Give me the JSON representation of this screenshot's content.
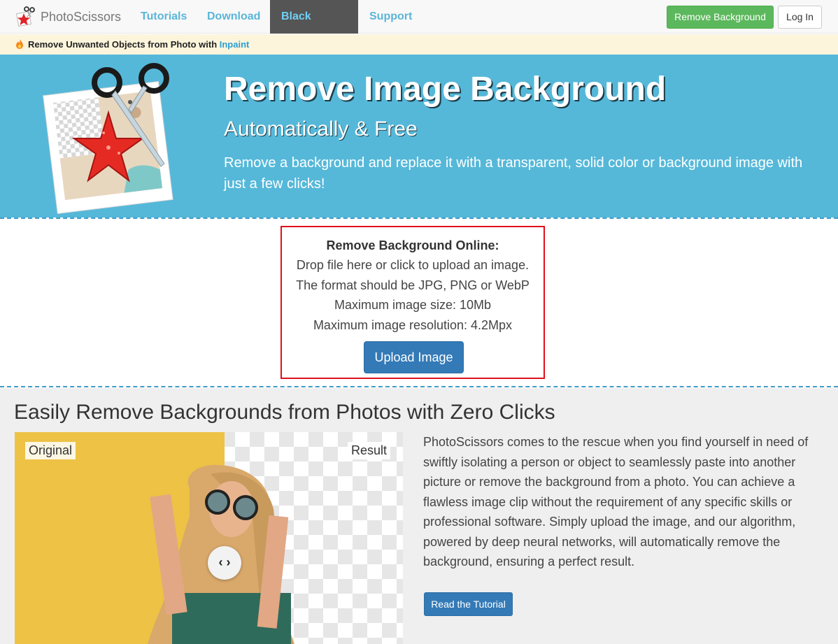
{
  "brand": {
    "name": "PhotoScissors",
    "logo_icon": "scissors-star-logo-icon"
  },
  "nav": {
    "links": [
      {
        "label": "Tutorials"
      },
      {
        "label": "Download"
      },
      {
        "label": "Black Friday"
      },
      {
        "label": "Support"
      }
    ],
    "remove_background_label": "Remove Background",
    "login_label": "Log In"
  },
  "notice": {
    "icon": "fire-icon",
    "text": "Remove Unwanted Objects from Photo with ",
    "link": "Inpaint"
  },
  "hero": {
    "title": "Remove Image Background",
    "subtitle": "Automatically & Free",
    "description": "Remove a background and replace it with a transparent, solid color or background image with just a few clicks!"
  },
  "upload": {
    "title": "Remove Background Online:",
    "lines": [
      "Drop file here or click to upload an image.",
      "The format should be JPG, PNG or WebP",
      "Maximum image size: 10Mb",
      "Maximum image resolution: 4.2Mpx"
    ],
    "button_label": "Upload Image"
  },
  "section": {
    "title": "Easily Remove Backgrounds from Photos with Zero Clicks",
    "compare": {
      "original_label": "Original",
      "result_label": "Result",
      "handle_glyph": "‹ ›"
    },
    "text": "PhotoScissors comes to the rescue when you find yourself in need of swiftly isolating a person or object to seamlessly paste into another picture or remove the background from a photo. You can achieve a flawless image clip without the requirement of any specific skills or professional software. Simply upload the image, and our algorithm, powered by deep neural networks, will automatically remove the background, ensuring a perfect result.",
    "tutorial_button": "Read the Tutorial"
  },
  "colors": {
    "hero_bg": "#55b8d9",
    "accent_blue": "#337ab7",
    "green_button": "#5cb85c",
    "highlight_border": "#e0101a",
    "nav_link": "#5bb5d9",
    "notice_bg": "#fcf5dc"
  }
}
